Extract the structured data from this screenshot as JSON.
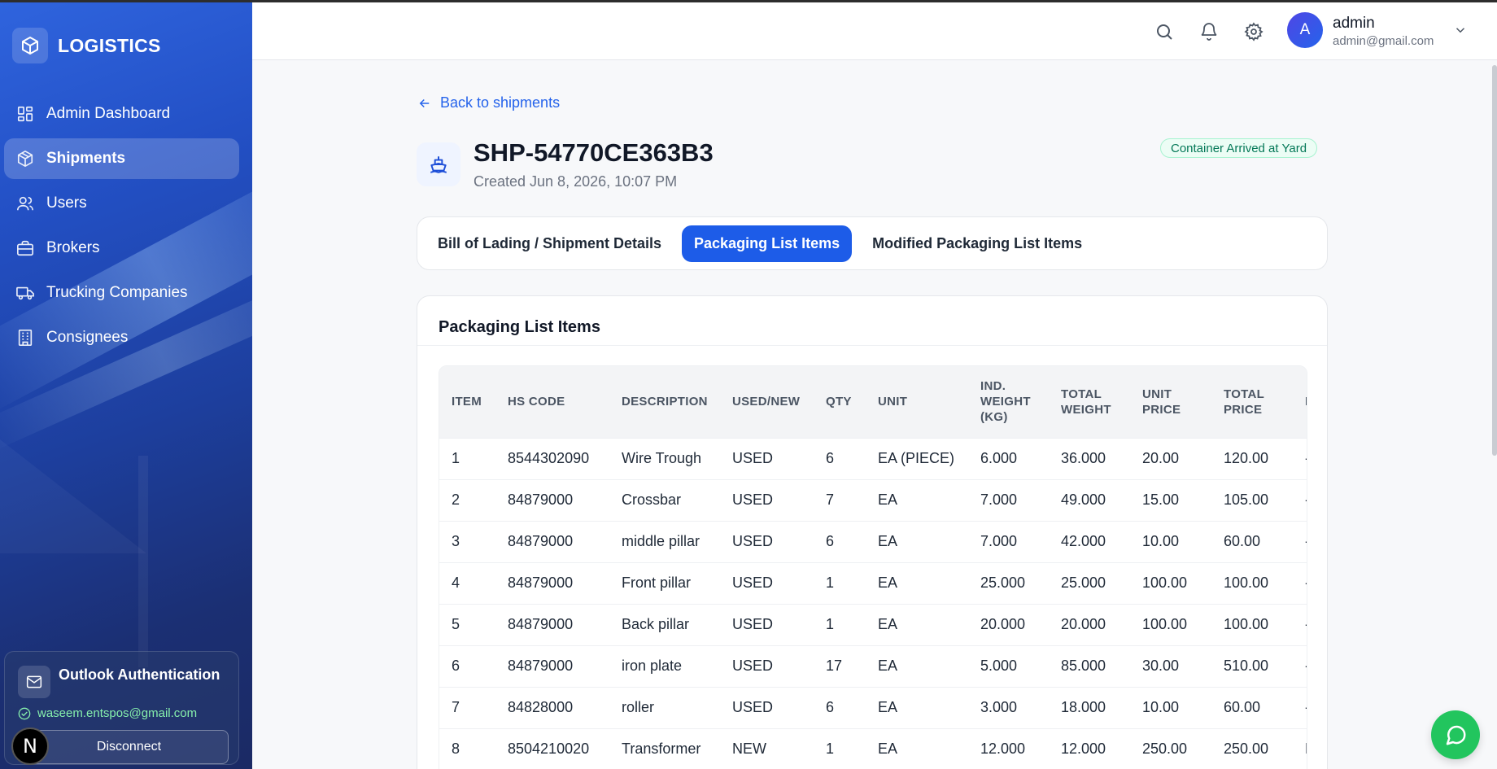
{
  "brand": {
    "name": "LOGISTICS",
    "icon": "box-icon"
  },
  "sidebar": {
    "items": [
      {
        "label": "Admin Dashboard",
        "icon": "dashboard-icon",
        "active": false
      },
      {
        "label": "Shipments",
        "icon": "package-icon",
        "active": true
      },
      {
        "label": "Users",
        "icon": "users-icon",
        "active": false
      },
      {
        "label": "Brokers",
        "icon": "briefcase-icon",
        "active": false
      },
      {
        "label": "Trucking Companies",
        "icon": "truck-icon",
        "active": false
      },
      {
        "label": "Consignees",
        "icon": "building-icon",
        "active": false
      }
    ],
    "outlook": {
      "title": "Outlook Authentication",
      "email": "waseem.entspos@gmail.com",
      "disconnect_label": "Disconnect"
    },
    "next_badge": "N"
  },
  "header": {
    "user_initial": "A",
    "user_name": "admin",
    "user_email": "admin@gmail.com"
  },
  "page": {
    "back_label": "Back to shipments",
    "shipment_id": "SHP-54770CE363B3",
    "created": "Created Jun 8, 2026, 10:07 PM",
    "status": "Container Arrived at Yard",
    "status_color": "#047857"
  },
  "tabs": [
    {
      "label": "Bill of Lading / Shipment Details",
      "active": false
    },
    {
      "label": "Packaging List Items",
      "active": true
    },
    {
      "label": "Modified Packaging List Items",
      "active": false
    }
  ],
  "table": {
    "title": "Packaging List Items",
    "columns": [
      "ITEM",
      "HS CODE",
      "DESCRIPTION",
      "USED/NEW",
      "QTY",
      "UNIT",
      "IND. WEIGHT (KG)",
      "TOTAL WEIGHT",
      "UNIT PRICE",
      "TOTAL PRICE",
      "B"
    ],
    "rows": [
      [
        "1",
        "8544302090",
        "Wire Trough",
        "USED",
        "6",
        "EA (PIECE)",
        "6.000",
        "36.000",
        "20.00",
        "120.00",
        "-"
      ],
      [
        "2",
        "84879000",
        "Crossbar",
        "USED",
        "7",
        "EA",
        "7.000",
        "49.000",
        "15.00",
        "105.00",
        "-"
      ],
      [
        "3",
        "84879000",
        "middle pillar",
        "USED",
        "6",
        "EA",
        "7.000",
        "42.000",
        "10.00",
        "60.00",
        "-"
      ],
      [
        "4",
        "84879000",
        "Front pillar",
        "USED",
        "1",
        "EA",
        "25.000",
        "25.000",
        "100.00",
        "100.00",
        "-"
      ],
      [
        "5",
        "84879000",
        "Back pillar",
        "USED",
        "1",
        "EA",
        "20.000",
        "20.000",
        "100.00",
        "100.00",
        "-"
      ],
      [
        "6",
        "84879000",
        "iron plate",
        "USED",
        "17",
        "EA",
        "5.000",
        "85.000",
        "30.00",
        "510.00",
        "-"
      ],
      [
        "7",
        "84828000",
        "roller",
        "USED",
        "6",
        "EA",
        "3.000",
        "18.000",
        "10.00",
        "60.00",
        "-"
      ],
      [
        "8",
        "8504210020",
        "Transformer",
        "NEW",
        "1",
        "EA",
        "12.000",
        "12.000",
        "250.00",
        "250.00",
        "B"
      ]
    ]
  },
  "colors": {
    "accent": "#1d5ce8",
    "sidebar": "#2350c5",
    "chat": "#22c55e"
  }
}
